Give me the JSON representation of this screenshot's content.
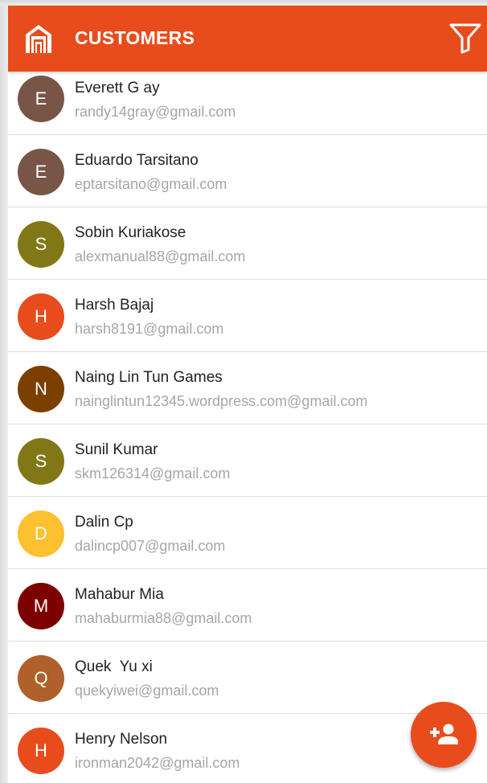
{
  "colors": {
    "accent": "#e84c1c",
    "header_text": "#ffffff",
    "name_text": "#222222",
    "email_text": "#a6a6a6",
    "divider": "#dedede"
  },
  "header": {
    "title": "CUSTOMERS",
    "logo_icon": "store-icon",
    "filter_icon": "filter-icon"
  },
  "customers": [
    {
      "initial": "E",
      "name": "Everett G ay",
      "email": "randy14gray@gmail.com",
      "avatar_color": "#795548"
    },
    {
      "initial": "E",
      "name": "Eduardo Tarsitano",
      "email": "eptarsitano@gmail.com",
      "avatar_color": "#795548"
    },
    {
      "initial": "S",
      "name": "Sobin Kuriakose",
      "email": "alexmanual88@gmail.com",
      "avatar_color": "#827717"
    },
    {
      "initial": "H",
      "name": "Harsh Bajaj",
      "email": "harsh8191@gmail.com",
      "avatar_color": "#e84c1c"
    },
    {
      "initial": "N",
      "name": "Naing Lin Tun Games",
      "email": "nainglintun12345.wordpress.com@gmail.com",
      "avatar_color": "#7b3f00"
    },
    {
      "initial": "S",
      "name": "Sunil Kumar",
      "email": "skm126314@gmail.com",
      "avatar_color": "#827717"
    },
    {
      "initial": "D",
      "name": "Dalin Cp",
      "email": "dalincp007@gmail.com",
      "avatar_color": "#fdc02f"
    },
    {
      "initial": "M",
      "name": "Mahabur Mia",
      "email": "mahaburmia88@gmail.com",
      "avatar_color": "#7d0000"
    },
    {
      "initial": "Q",
      "name": "Quek  Yu xi",
      "email": "quekyiwei@gmail.com",
      "avatar_color": "#b0602a"
    },
    {
      "initial": "H",
      "name": "Henry Nelson",
      "email": "ironman2042@gmail.com",
      "avatar_color": "#e84c1c"
    }
  ],
  "fab": {
    "icon": "add-person-icon"
  }
}
